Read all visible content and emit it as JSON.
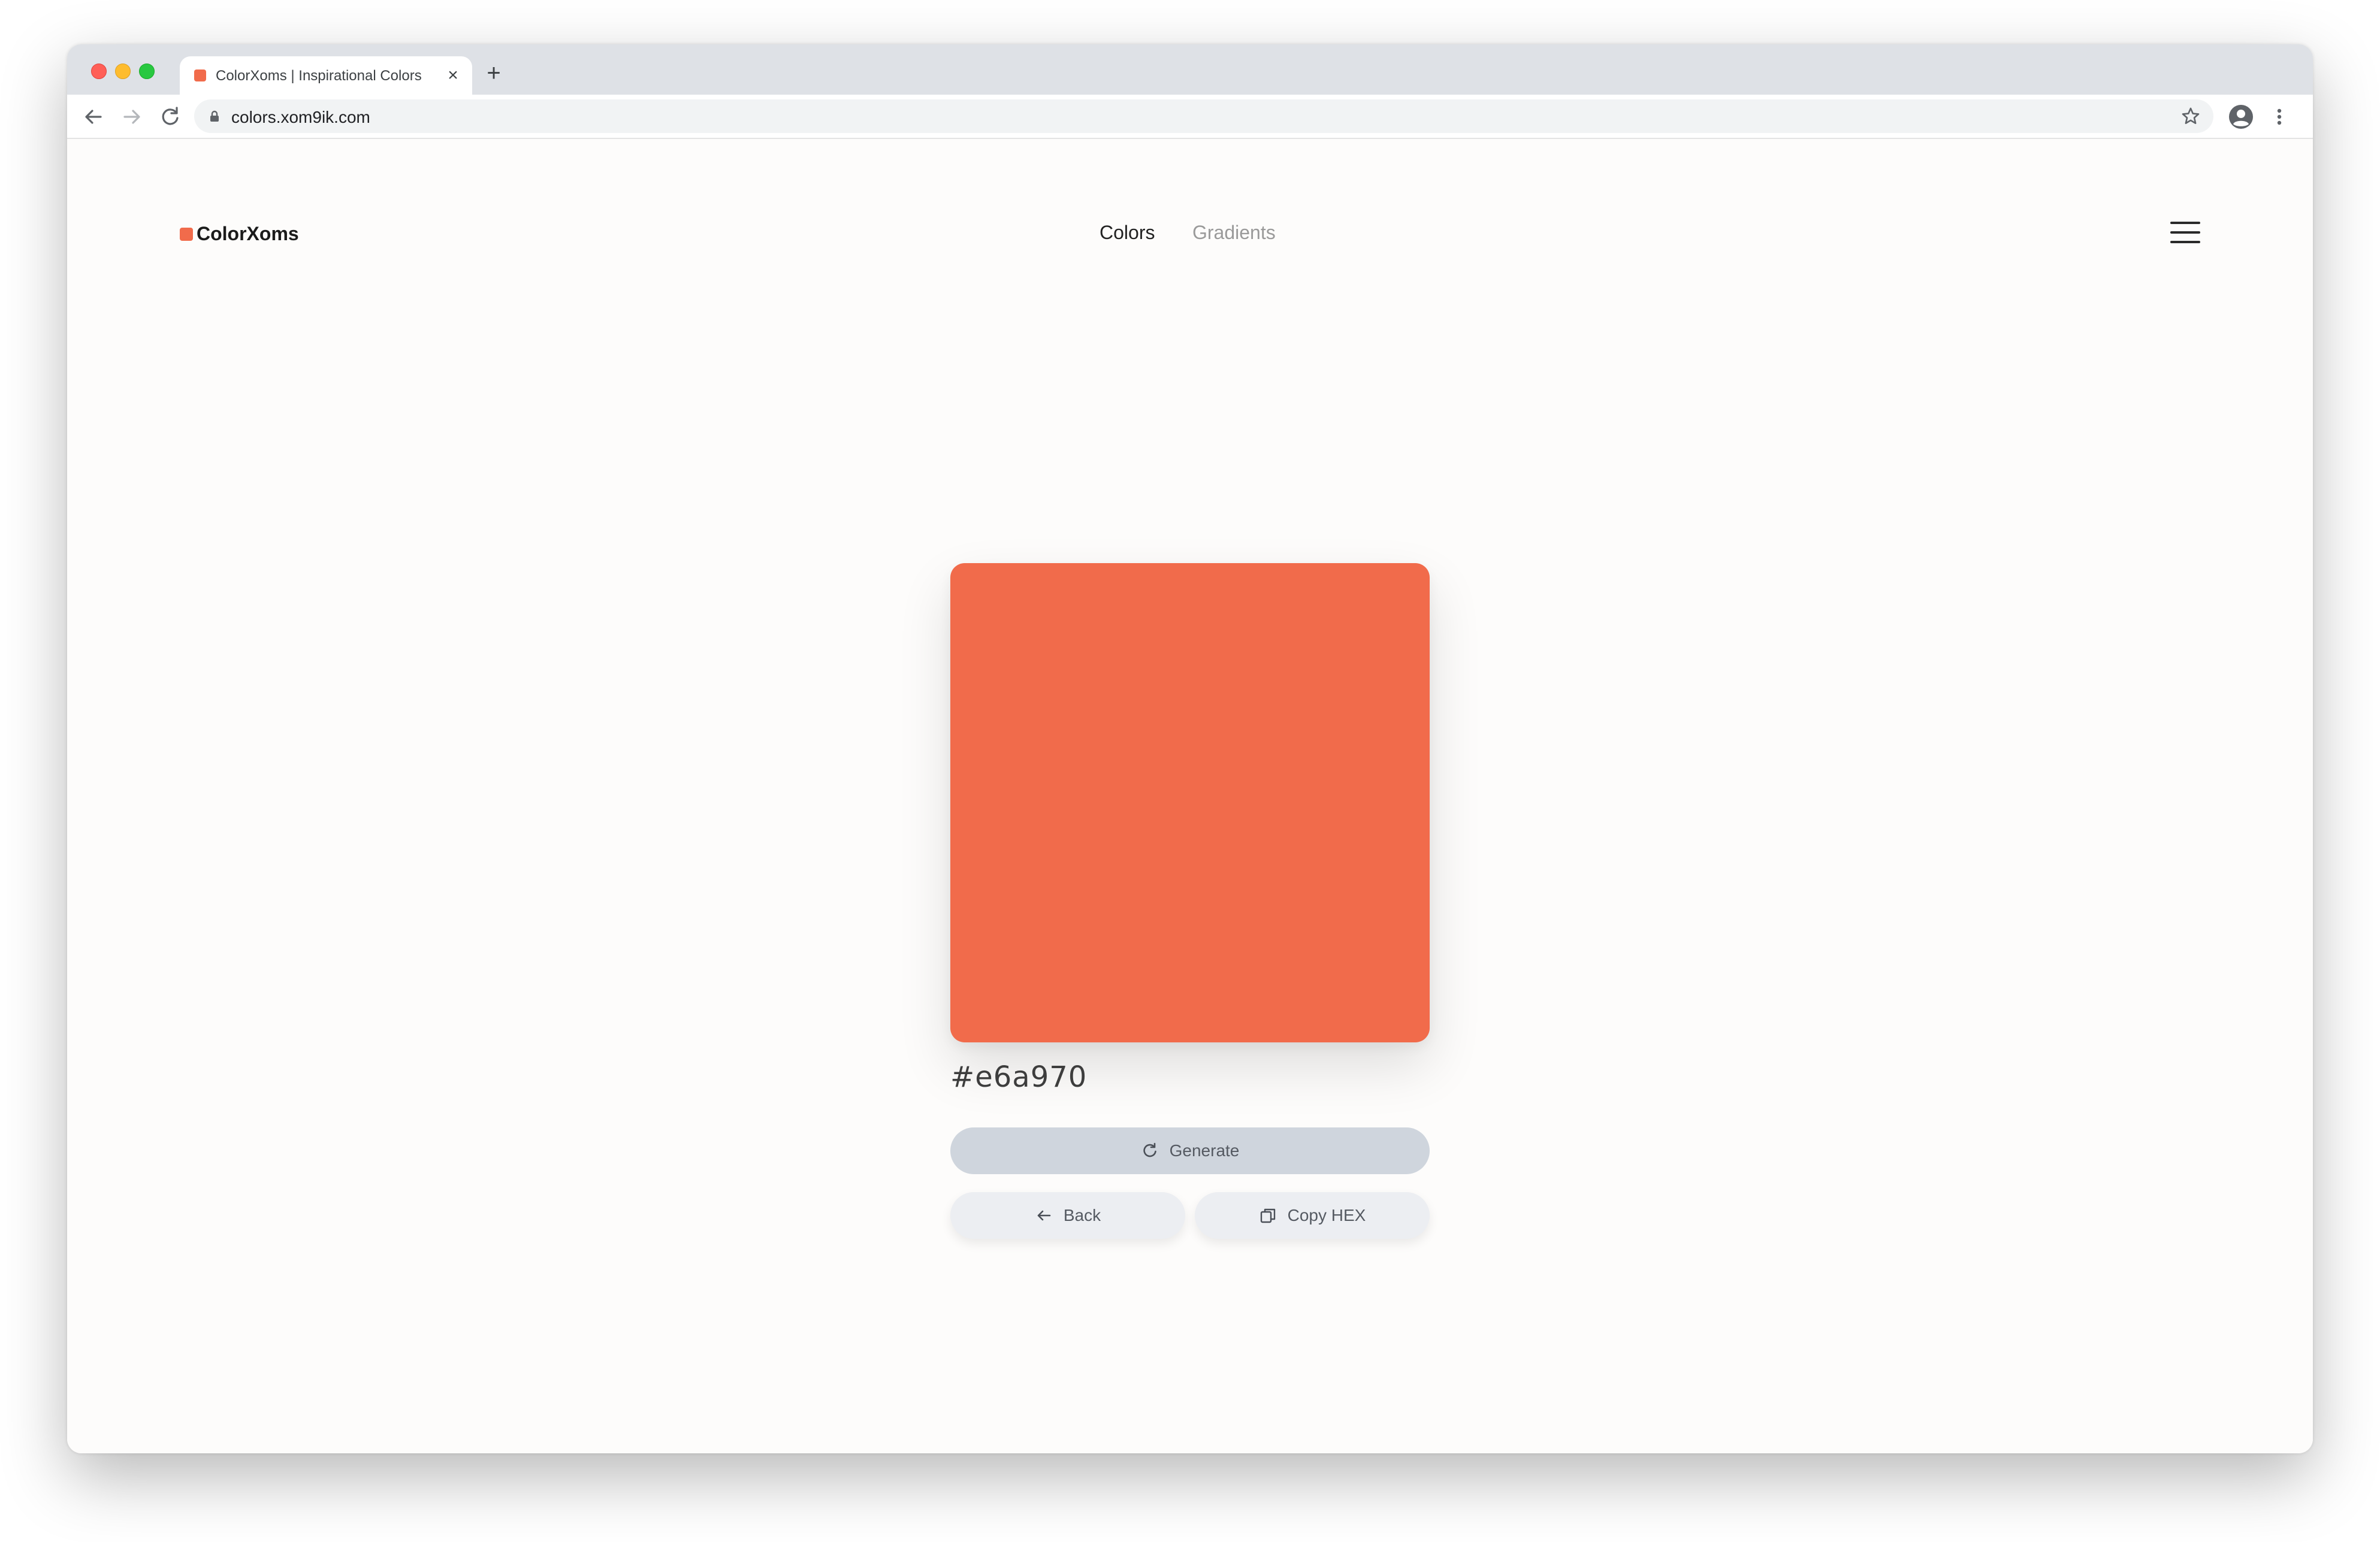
{
  "browser": {
    "tab": {
      "title": "ColorXoms | Inspirational Colors",
      "favicon_color": "#f16b4b",
      "close_icon": "×"
    },
    "new_tab_icon": "+",
    "address_bar": {
      "url": "colors.xom9ik.com"
    }
  },
  "header": {
    "logo_text": "ColorXoms",
    "logo_color": "#f16b4b",
    "nav": {
      "colors_label": "Colors",
      "gradients_label": "Gradients"
    }
  },
  "main": {
    "color": {
      "swatch_color": "#f16b4b",
      "hex_label": "#e6a970"
    },
    "buttons": {
      "generate_label": "Generate",
      "back_label": "Back",
      "copy_label": "Copy HEX"
    }
  },
  "icons": {
    "back": "arrow-left-icon",
    "forward": "arrow-right-icon",
    "reload": "reload-icon",
    "lock": "lock-icon",
    "bookmark": "star-icon",
    "profile": "profile-icon",
    "menu": "kebab-menu-icon",
    "hamburger": "hamburger-menu-icon",
    "generate": "refresh-icon",
    "copy": "copy-icon"
  }
}
